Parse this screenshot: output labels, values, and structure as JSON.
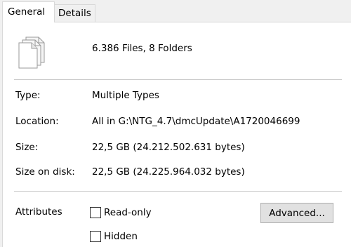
{
  "tabs": [
    {
      "label": "General"
    },
    {
      "label": "Details"
    }
  ],
  "summary": {
    "text": "6.386 Files, 8 Folders",
    "icon": "multiple-files-icon"
  },
  "properties": [
    {
      "label": "Type:",
      "value": "Multiple Types"
    },
    {
      "label": "Location:",
      "value": "All in G:\\NTG_4.7\\dmcUpdate\\A1720046699"
    },
    {
      "label": "Size:",
      "value": "22,5 GB (24.212.502.631 bytes)"
    },
    {
      "label": "Size on disk:",
      "value": "22,5 GB (24.225.964.032 bytes)"
    }
  ],
  "attributes": {
    "label": "Attributes",
    "readonly": {
      "label": "Read-only",
      "checked": false
    },
    "hidden": {
      "label": "Hidden",
      "checked": false
    },
    "advanced_button": "Advanced..."
  }
}
